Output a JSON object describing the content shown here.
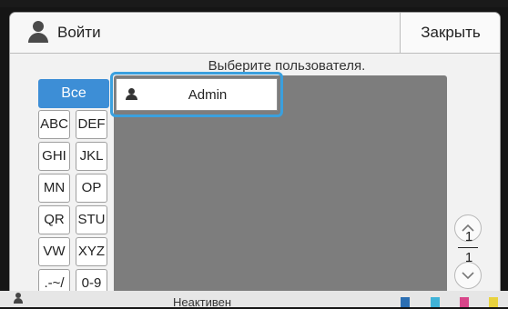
{
  "dialog": {
    "title": "Войти",
    "close_label": "Закрыть",
    "prompt": "Выберите пользователя."
  },
  "filters": {
    "all": "Все",
    "items": [
      "ABC",
      "DEF",
      "GHI",
      "JKL",
      "MN",
      "OP",
      "QR",
      "STU",
      "VW",
      "XYZ",
      ".-~/",
      "0-9"
    ]
  },
  "users": [
    "Admin"
  ],
  "pager": {
    "current": "1",
    "total": "1"
  },
  "status": {
    "text": "Неактивен"
  },
  "colors": {
    "accent": "#3d8ed6",
    "highlight": "#3aa0de",
    "list_bg": "#7d7d7d"
  }
}
